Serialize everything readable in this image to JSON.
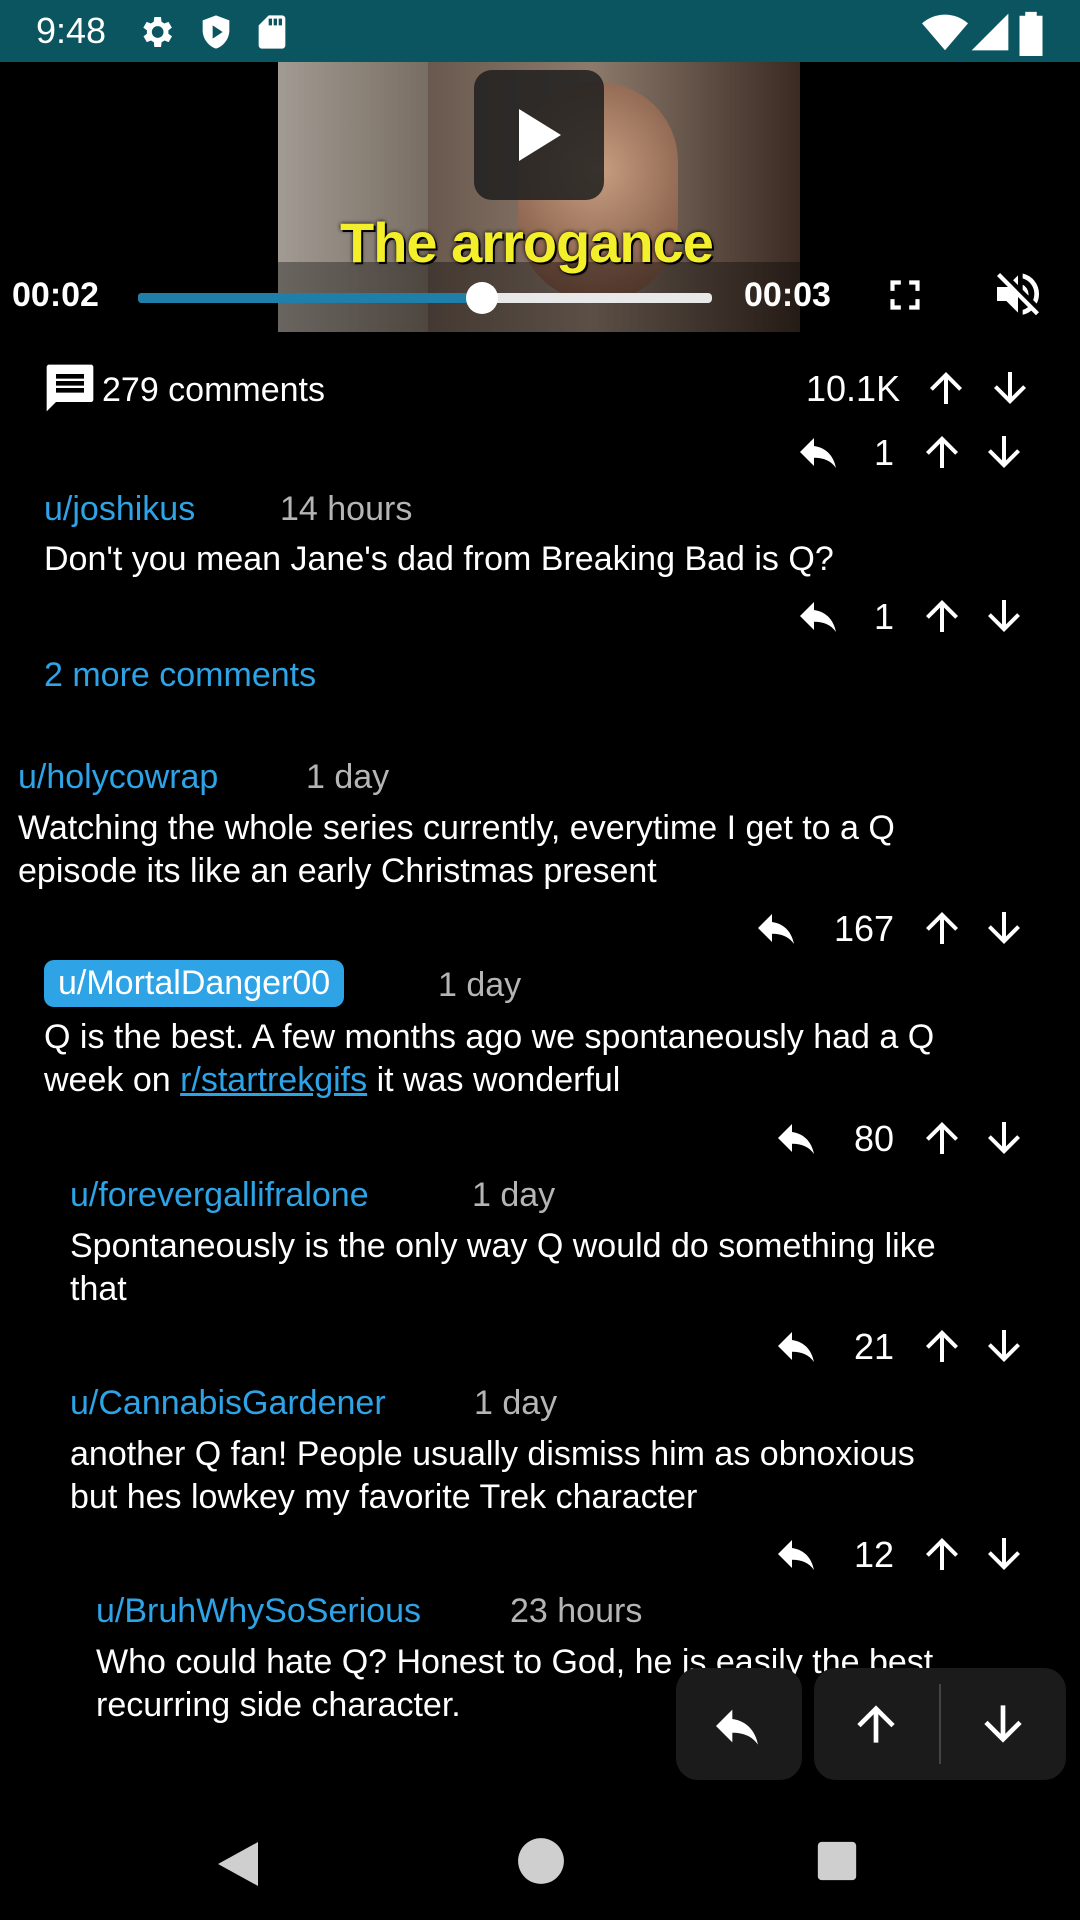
{
  "status_bar": {
    "time": "9:48"
  },
  "video": {
    "caption": "The arrogance",
    "current_time": "00:02",
    "duration": "00:03",
    "progress": 0.6,
    "muted": true
  },
  "post": {
    "comments_count": "279 comments",
    "score": "10.1K"
  },
  "comments": [
    {
      "votes": "1"
    },
    {
      "user": "u/joshikus",
      "age": "14 hours",
      "text": "Don't you mean Jane's dad from Breaking Bad is Q?",
      "votes": "1"
    },
    {
      "more": "2 more comments"
    },
    {
      "user": "u/holycowrap",
      "age": "1 day",
      "line1": "Watching the whole series currently, everytime I get to a Q",
      "line2": "episode its like an early Christmas present",
      "votes": "167"
    },
    {
      "user": "u/MortalDanger00",
      "age": "1 day",
      "line1": "Q is the best.  A few months ago we spontaneously had a Q",
      "line2_pre": "week on ",
      "link": "r/startrekgifs",
      "line2_post": " it was wonderful",
      "votes": "80"
    },
    {
      "user": "u/forevergallifralone",
      "age": "1 day",
      "line1": "Spontaneously is the only way Q would do something like",
      "line2": "that",
      "votes": "21"
    },
    {
      "user": "u/CannabisGardener",
      "age": "1 day",
      "line1": "another Q fan! People usually dismiss him as obnoxious",
      "line2": "but hes lowkey my favorite Trek character",
      "votes": "12"
    },
    {
      "user": "u/BruhWhySoSerious",
      "age": "23 hours",
      "line1": "Who could hate Q? Honest to God, he is easily the best",
      "line2": "recurring side character."
    }
  ]
}
